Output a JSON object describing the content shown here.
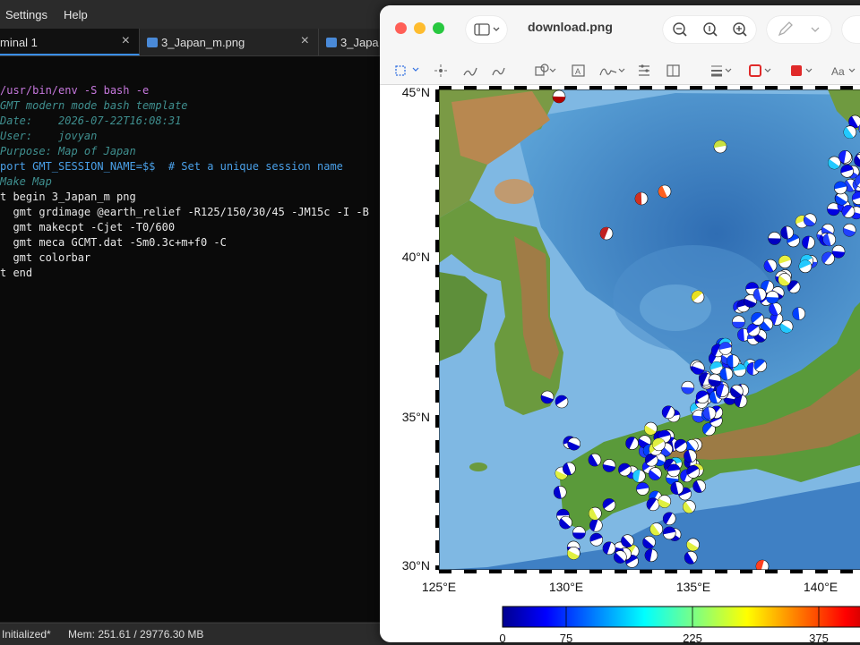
{
  "menubar": {
    "settings": "Settings",
    "help": "Help"
  },
  "tabs": [
    {
      "label": "minal 1"
    },
    {
      "label": "3_Japan_m.png"
    },
    {
      "label": "3_Japa"
    }
  ],
  "terminal": {
    "lines": [
      "/usr/bin/env -S bash -e",
      "GMT modern mode bash template",
      "Date:    2026-07-22T16:08:31",
      "User:    jovyan",
      "Purpose: Map of Japan",
      "port GMT_SESSION_NAME=$$  # Set a unique session name",
      "Make Map",
      "t begin 3_Japan_m png",
      "  gmt grdimage @earth_relief -R125/150/30/45 -JM15c -I -B",
      "  gmt makecpt -Cjet -T0/600",
      "  gmt meca GCMT.dat -Sm0.3c+m+f0 -C",
      "  gmt colorbar",
      "t end"
    ]
  },
  "status": {
    "left": "Initialized*",
    "mem": "Mem: 251.61 / 29776.30 MB"
  },
  "preview": {
    "title": "download.png",
    "map": {
      "lat_labels": [
        "45°N",
        "40°N",
        "35°N",
        "30°N"
      ],
      "lon_labels": [
        "125°E",
        "130°E",
        "135°E",
        "140°E"
      ],
      "colorbar_labels": [
        "0",
        "75",
        "225",
        "375"
      ]
    }
  },
  "colors": {
    "accent": "#3a8ee6",
    "close": "#ff5f57",
    "minimize": "#febc2e",
    "zoom": "#28c840"
  }
}
